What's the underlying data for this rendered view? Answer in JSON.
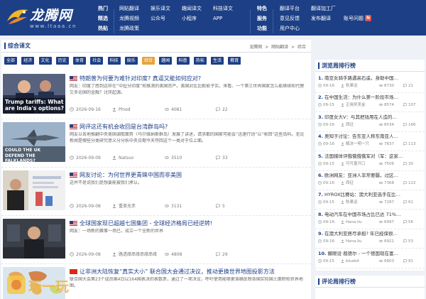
{
  "site": {
    "logo_text": "龙腾网",
    "logo_url": "www.ltaaa.cn",
    "colors": {
      "brand": "#1c3f86",
      "accent": "#e8a33c",
      "badge": "#d9534f"
    }
  },
  "nav": {
    "col1": [
      "热门",
      "精选",
      "热贴"
    ],
    "col2": [
      "网贴翻译",
      "龙腾视频",
      "龙腾政策"
    ],
    "col3": [
      "娱乐译文",
      "公众号"
    ],
    "col4": [
      "趣闻译文",
      "小程序"
    ],
    "col5": [
      "科技译文",
      "APP"
    ],
    "col6": [
      "特色",
      "服务",
      "功能"
    ],
    "col7": [
      "翻译平台",
      "意见反馈",
      "用户中心"
    ],
    "col8": [
      "翻译加工厂",
      "发布翻译"
    ],
    "col9_text": "账号问题",
    "col9_badge": "N"
  },
  "main": {
    "section_title": "综合译文",
    "breadcrumb": [
      "龙腾网",
      ">",
      "网贴翻译",
      ">",
      "综合"
    ],
    "categories": [
      "全部",
      "经济",
      "文化",
      "历史",
      "体育",
      "社会",
      "科技",
      "娱乐",
      "综合",
      "趣闻",
      "科普",
      "热帖",
      "生活",
      "教育"
    ],
    "active_category": "综合",
    "articles": [
      {
        "flag": "us",
        "title": "特朗普为何要为难针对印度? 真逼又能如何应对?",
        "desc": "网友：印度了感到这样在“中扯分印度”和推测的美国资产。美国对比比較影子实。来看、一个第三世界国家怎么能继续和代替欠多论国的金融？讨厌起源。",
        "thumb_caption": "Trump tariffs: What are India's options?",
        "date": "2026-09-16",
        "author": "Plnod",
        "views": "4081",
        "comments": "22"
      },
      {
        "flag": "us",
        "title": "网评这还有机会收回是台湾群岛吗?",
        "desc": "网友以各地推翻中央美国调取面势（马尔维纳斯群岛）发展了讲述，请求都的国家可能会“迅速行动”以“收回”这些岛屿。无论新闻是哪些分类研究意义分分析中央日期今天夺回这个一类对于位上面。",
        "thumb_caption": "COULD THE UK DEFEND THE FALKLANDS?",
        "date": "2026-09-09",
        "author": "Natsuo",
        "views": "3510",
        "comments": "33"
      },
      {
        "flag": "us",
        "title": "网友讨论：为何世界更青睐中国而非美国",
        "desc": "这并不是说我们是想要能被我们承认。",
        "thumb_caption": "",
        "date": "2026-09-08",
        "author": "重美无赤",
        "views": "3131",
        "comments": "5"
      },
      {
        "flag": "us",
        "title": "全球国家现已超越七国集团 - 全球经济格局已经逆转!",
        "desc": "网友：一场新的赛事一场已，成立一个全新的世界",
        "thumb_caption": "",
        "date": "2026-09-08",
        "author": "路透缘串缘串缘串缘",
        "views": "4808",
        "comments": "29"
      },
      {
        "flag": "cn",
        "title": "让非洲大陆恢复“真实大小” 联合国大会通过决议，推动更换世界地图投影方法",
        "desc": "联合国大会第23个成员国4日以164国表决的表数票，通过了一项决议，呼吁使用能够更准确反映各国实际国土面积和世界地图。",
        "thumb_caption": "",
        "date": "",
        "author": "",
        "views": "",
        "comments": ""
      }
    ]
  },
  "sidebar": {
    "ranking_title": "浏览周排行榜",
    "ranking": [
      {
        "num": "1.",
        "title": "南亚女骑手路遇高石遥，身助中国…",
        "date": "09-16",
        "author": "秋果运",
        "views": "8730",
        "comments": "21"
      },
      {
        "num": "2.",
        "title": "在中国生活：为什么第一阶段市场…",
        "date": "09-15",
        "author": "正晓奖奖金",
        "views": "8574",
        "comments": "107"
      },
      {
        "num": "3.",
        "title": "印度女大V：与其把钱用在人造的…",
        "date": "09-16",
        "author": "西征",
        "views": "8534",
        "comments": "166"
      },
      {
        "num": "4.",
        "title": "奥知于讨论：告东亚人称东南亚人…",
        "date": "09-16",
        "author": "解决一明一只",
        "views": "7837",
        "comments": "113"
      },
      {
        "num": "5.",
        "title": "法国媒体评俄俄俄俄军对（军：这家…",
        "date": "09-15",
        "author": "可可夏开口",
        "views": "7506",
        "comments": "30"
      },
      {
        "num": "6.",
        "title": "欧洲网友：亚洲人非常要疆，过区…",
        "date": "09-16",
        "author": "西征",
        "views": "7368",
        "comments": "122"
      },
      {
        "num": "7.",
        "title": "HYROX比赛站：澳大利亚选手在比…",
        "date": "09-15",
        "author": "秋果运",
        "views": "7287",
        "comments": "61"
      },
      {
        "num": "8.",
        "title": "电动汽车在中国市场占比已达 71%…",
        "date": "09-16",
        "author": "Hana.liu",
        "views": "6997",
        "comments": "56"
      },
      {
        "num": "9.",
        "title": "在澳大利亚居尽承担? 年已经保很…",
        "date": "09-16",
        "author": "Hana.liu",
        "views": "6921",
        "comments": "53"
      },
      {
        "num": "10.",
        "title": "撇眼设·裁德尔 - 一个德国现在富…",
        "date": "09-15",
        "author": "bluebit",
        "views": "6803",
        "comments": "91"
      }
    ],
    "comment_rank_title": "评论周排行榜"
  },
  "watermark_text": "玩一玩"
}
